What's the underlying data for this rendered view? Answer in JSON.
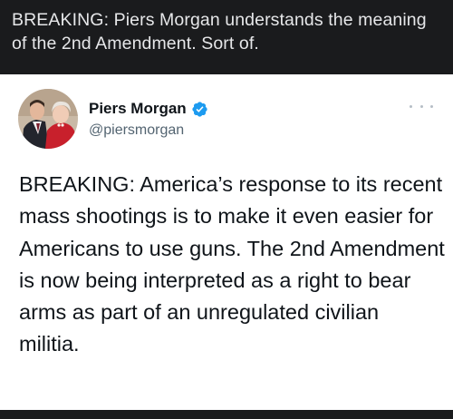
{
  "post": {
    "title": "BREAKING: Piers Morgan understands the meaning of the 2nd Amendment. Sort of."
  },
  "tweet": {
    "author": {
      "name": "Piers Morgan",
      "handle": "@piersmorgan",
      "verified": true
    },
    "text": "BREAKING: America’s response to its recent mass shootings is to make it even easier for Americans to use guns. The 2nd Amendment is now being interpreted as a right to bear arms as part of an unregulated civilian militia.",
    "more_icon": "more-horizontal-icon"
  },
  "colors": {
    "background_dark": "#1a1b1d",
    "title_text": "#e6e7e9",
    "card_background": "#ffffff",
    "text_primary": "#0f1419",
    "text_secondary": "#536471",
    "verified_blue": "#1d9bf0"
  }
}
